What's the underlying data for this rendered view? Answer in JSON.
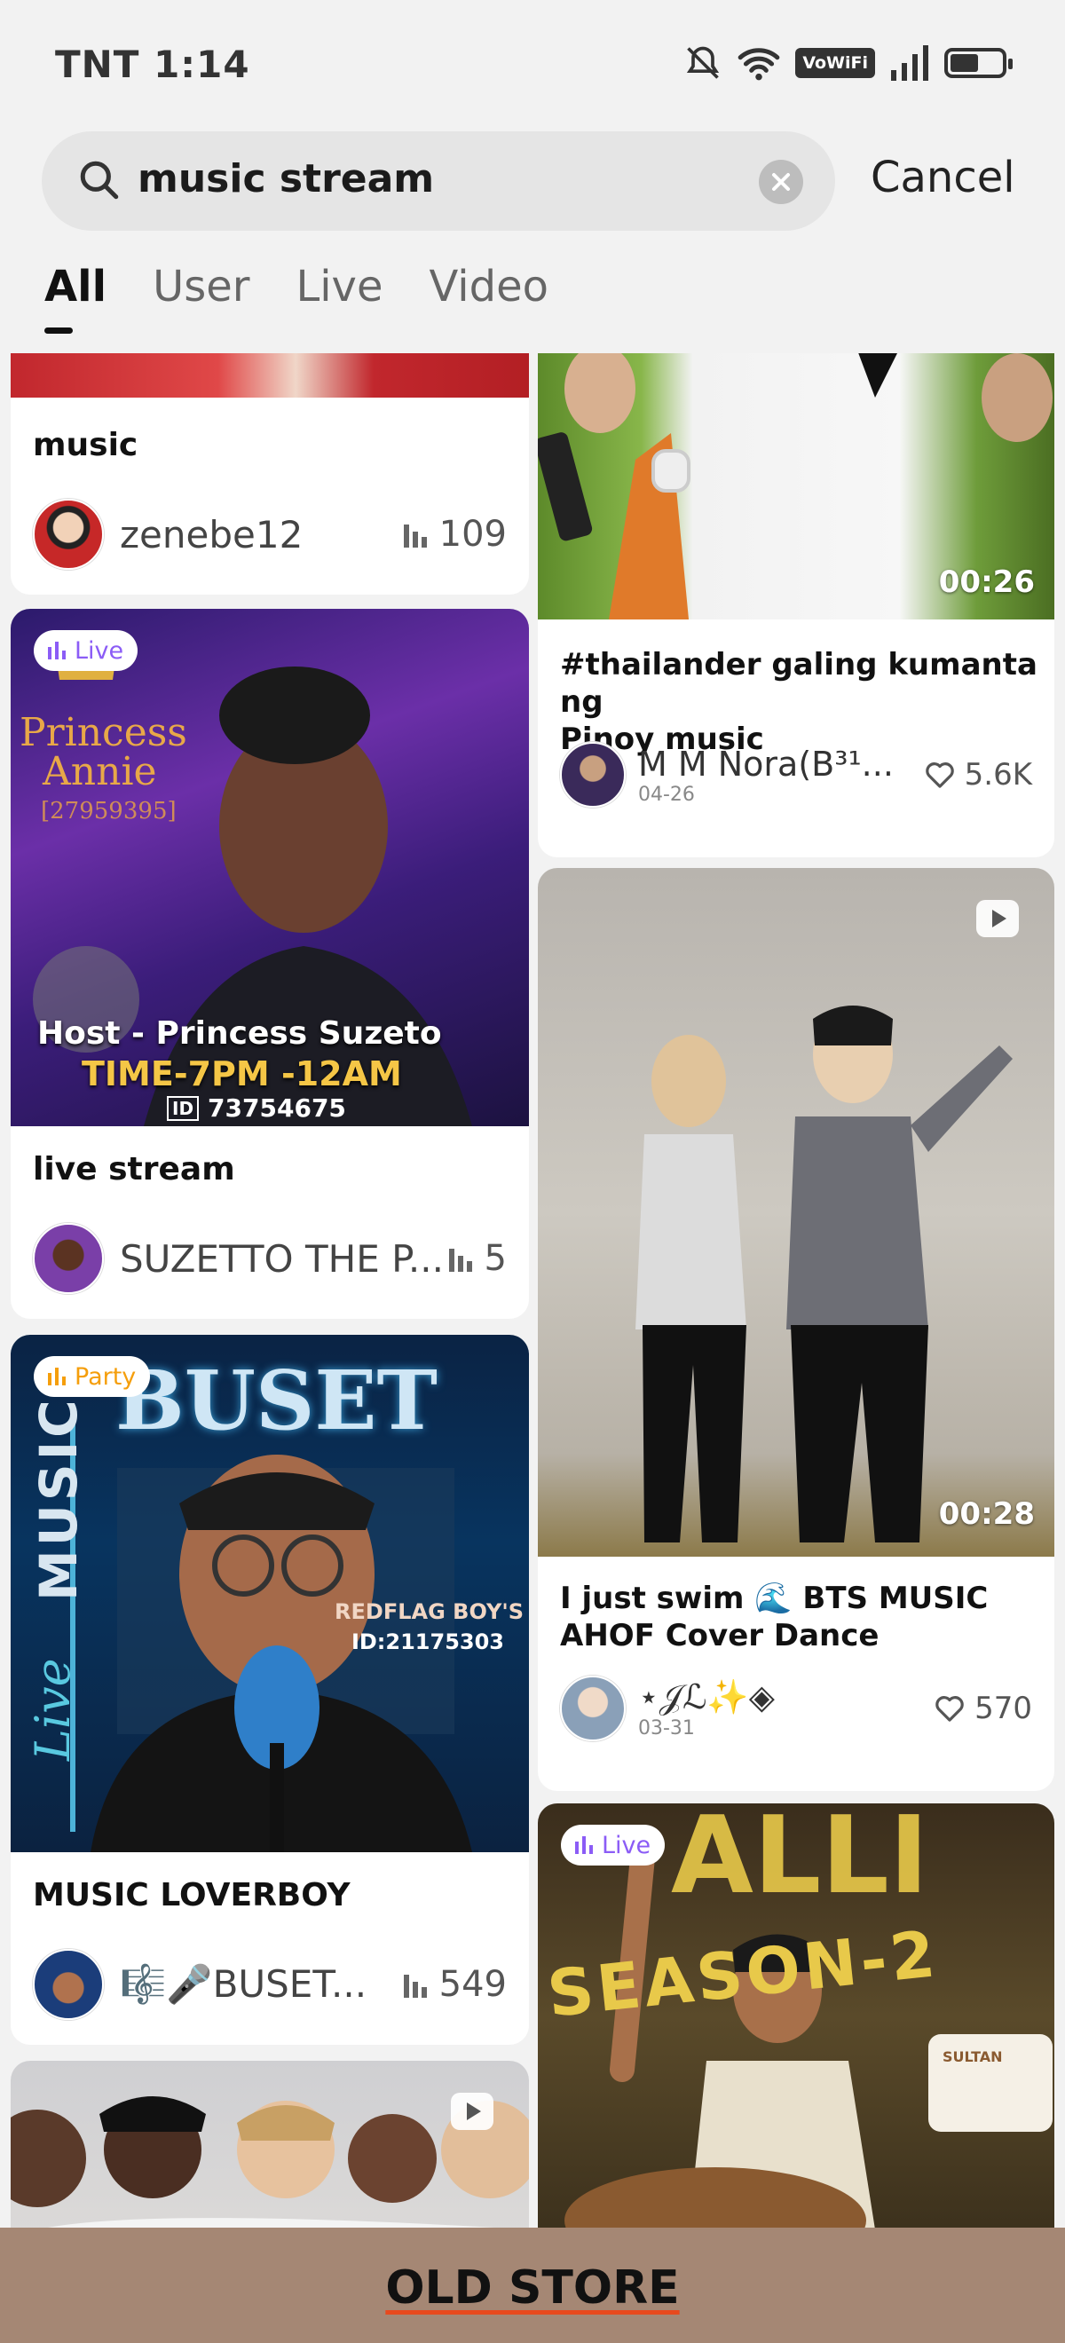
{
  "status_bar": {
    "time": "TNT 1:14",
    "network_badge": "VoWiFi",
    "battery_level": 0.55
  },
  "search": {
    "query": "music stream",
    "cancel_label": "Cancel"
  },
  "tabs": [
    {
      "label": "All",
      "active": true
    },
    {
      "label": "User",
      "active": false
    },
    {
      "label": "Live",
      "active": false
    },
    {
      "label": "Video",
      "active": false
    }
  ],
  "left_column": [
    {
      "caption": "music",
      "user": "zenebe12",
      "count": "109"
    },
    {
      "badge": "Live",
      "overlay_title_1": "Princess",
      "overlay_title_2": "Annie",
      "overlay_id": "[27959395]",
      "overlay_host": "Host - Princess Suzeto",
      "overlay_time": "TIME-7PM -12AM",
      "overlay_room_id": "73754675",
      "caption": "live stream",
      "user": "SUZETTO THE P...",
      "count": "5"
    },
    {
      "badge": "Party",
      "overlay_title": "BUSET",
      "overlay_side": "MUSIC",
      "overlay_live": "Live",
      "overlay_tag": "REDFLAG BOY'S",
      "overlay_id": "ID:21175303",
      "caption": "MUSIC LOVERBOY",
      "user": "🎼🎤BUSET...",
      "count": "549"
    },
    {
      "type": "video"
    }
  ],
  "right_column": [
    {
      "duration": "00:26",
      "caption_line1": "#thailander galing kumanta ng",
      "caption_line2": "Pinoy music",
      "user": "M M Nora(B³¹...",
      "date": "04-26",
      "likes": "5.6K"
    },
    {
      "duration": "00:28",
      "caption_line1": "I just swim 🌊 BTS MUSIC",
      "caption_line2": "AHOF Cover Dance",
      "user": "⋆𝒥ℒ✨◈",
      "date": "03-31",
      "likes": "570"
    },
    {
      "badge": "Live",
      "overlay_title": "SEASON-2",
      "overlay_sign": "SULTAN"
    }
  ],
  "store_banner": {
    "label": "OLD STORE"
  },
  "colors": {
    "live_badge": "#8b5cf6",
    "party_badge": "#f59e0b",
    "store_bg": "#a58774",
    "underline": "#e8491d"
  }
}
